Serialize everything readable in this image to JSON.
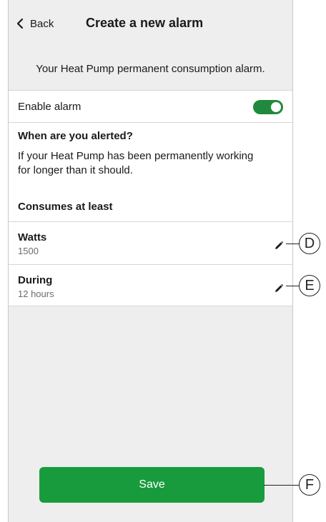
{
  "header": {
    "back_label": "Back",
    "title": "Create a new alarm"
  },
  "description": "Your Heat Pump permanent consumption alarm.",
  "enable_alarm": {
    "label": "Enable alarm",
    "enabled": true
  },
  "info": {
    "question": "When are you alerted?",
    "text": "If your Heat Pump has been permanently working for longer than it should.",
    "consumes_label": "Consumes at least"
  },
  "settings": [
    {
      "label": "Watts",
      "value": "1500"
    },
    {
      "label": "During",
      "value": "12 hours"
    }
  ],
  "save_label": "Save",
  "callouts": [
    "D",
    "E",
    "F"
  ],
  "colors": {
    "accent": "#189b3c",
    "toggle_on": "#1f8a3b",
    "background": "#eeeeee"
  },
  "icons": {
    "back": "chevron-left-icon",
    "edit": "pencil-icon"
  }
}
